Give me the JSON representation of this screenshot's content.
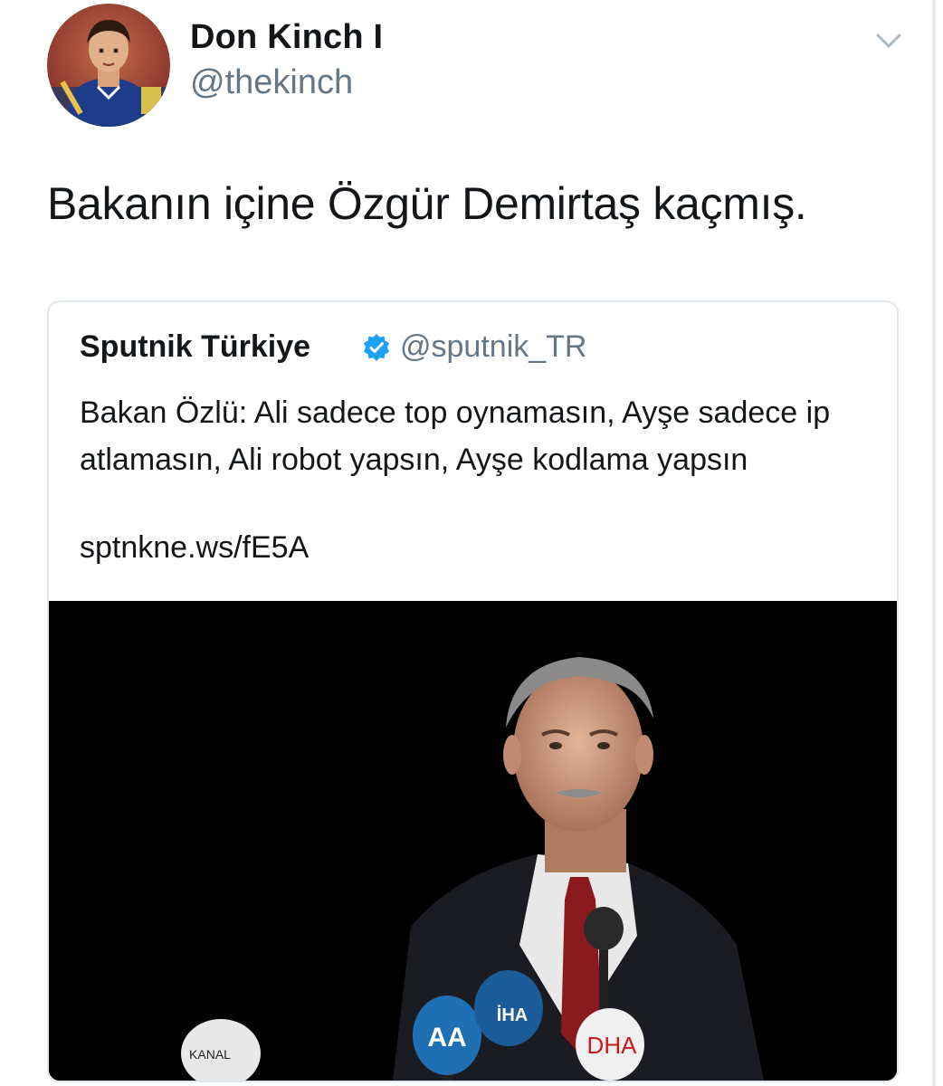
{
  "tweet": {
    "author": {
      "display_name": "Don Kinch I",
      "handle": "@thekinch",
      "avatar_icon": "child-portrait-avatar"
    },
    "menu_icon": "chevron-down-icon",
    "text": "Bakanın içine Özgür Demirtaş kaçmış."
  },
  "quoted_tweet": {
    "author": {
      "display_name": "Sputnik Türkiye",
      "verified": true,
      "handle": "@sputnik_TR"
    },
    "text": "Bakan Özlü: Ali sadece top oynamasın, Ayşe sadece ip atlamasın, Ali robot yapsın, Ayşe kodlama yapsın",
    "link": "sptnkne.ws/fE5A",
    "media": {
      "description_icon": "press-conference-photo",
      "mic_logos": [
        "AA",
        "İHA",
        "DHA",
        "KANAL"
      ]
    }
  },
  "colors": {
    "text_primary": "#14171a",
    "text_secondary": "#657786",
    "verified_blue": "#1da1f2",
    "card_border": "#e1e8ed",
    "media_background": "#000000"
  }
}
